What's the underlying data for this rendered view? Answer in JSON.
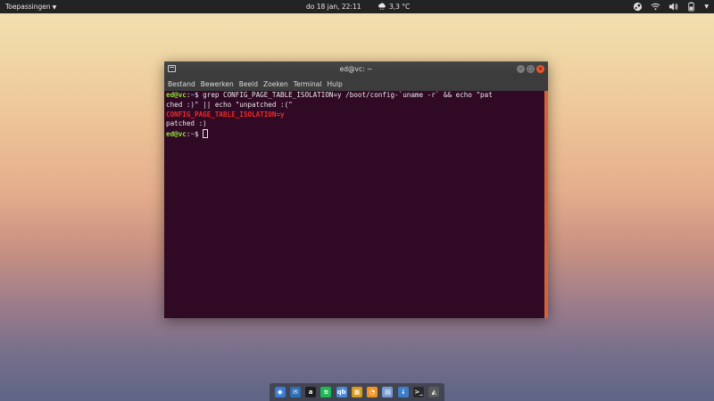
{
  "topbar": {
    "apps_label": "Toepassingen",
    "datetime": "do 18 jan, 22:11",
    "weather": "3,3 °C"
  },
  "window": {
    "title": "ed@vc: ~",
    "menu": [
      "Bestand",
      "Bewerken",
      "Beeld",
      "Zoeken",
      "Terminal",
      "Hulp"
    ]
  },
  "terminal": {
    "prompt_user": "ed@vc",
    "prompt_sep": ":",
    "prompt_dir": "~",
    "prompt_end": "$ ",
    "command_line1": "grep CONFIG_PAGE_TABLE_ISOLATION=y /boot/config-`uname -r` && echo \"pat",
    "command_line2": "ched :)\" || echo \"unpatched :(\"",
    "match_output": "CONFIG_PAGE_TABLE_ISOLATION=y",
    "result_output": "patched :)"
  },
  "dock": {
    "items": [
      {
        "name": "firefox-icon",
        "color": "#3a7bd5",
        "glyph": "◉"
      },
      {
        "name": "thunderbird-icon",
        "color": "#2f6fb5",
        "glyph": "✉"
      },
      {
        "name": "anbox-icon",
        "color": "#1e1e1e",
        "glyph": "a"
      },
      {
        "name": "spotify-icon",
        "color": "#1db954",
        "glyph": "≋"
      },
      {
        "name": "qbittorrent-icon",
        "color": "#4a8ad8",
        "glyph": "qb"
      },
      {
        "name": "puzzle-app-icon",
        "color": "#d89b1c",
        "glyph": "▦"
      },
      {
        "name": "rss-reader-icon",
        "color": "#f29423",
        "glyph": "◔"
      },
      {
        "name": "notes-icon",
        "color": "#7a9ccf",
        "glyph": "▤"
      },
      {
        "name": "download-icon",
        "color": "#3d7ec8",
        "glyph": "↓"
      },
      {
        "name": "terminal-icon",
        "color": "#2a2a2a",
        "glyph": ">_"
      },
      {
        "name": "gpu-app-icon",
        "color": "#5a5a5a",
        "glyph": "◭"
      }
    ]
  }
}
